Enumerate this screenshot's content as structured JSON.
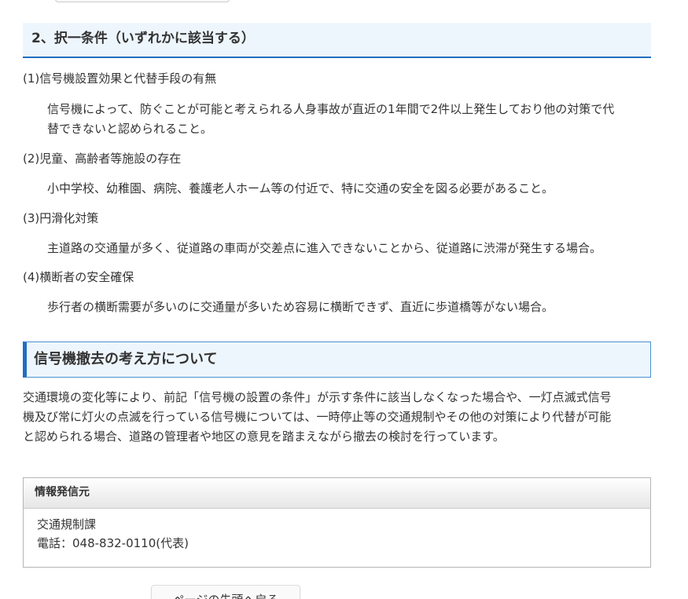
{
  "selection_section": {
    "heading": "2、択一条件（いずれかに該当する）",
    "conditions": [
      {
        "title": "(1)信号機設置効果と代替手段の有無",
        "desc_lines": [
          "信号機によって、防ぐことが可能と考えられる人身事故が直近の1年間で2件以上発生しており他の対策で代",
          "替できないと認められること。"
        ]
      },
      {
        "title": "(2)児童、高齢者等施設の存在",
        "desc_lines": [
          "小中学校、幼稚園、病院、養護老人ホーム等の付近で、特に交通の安全を図る必要があること。"
        ]
      },
      {
        "title": "(3)円滑化対策",
        "desc_lines": [
          "主道路の交通量が多く、従道路の車両が交差点に進入できないことから、従道路に渋滞が発生する場合。"
        ]
      },
      {
        "title": "(4)横断者の安全確保",
        "desc_lines": [
          "歩行者の横断需要が多いのに交通量が多いため容易に横断できず、直近に歩道橋等がない場合。"
        ]
      }
    ]
  },
  "removal_section": {
    "heading": "信号機撤去の考え方について",
    "body_lines": [
      "交通環境の変化等により、前記「信号機の設置の条件」が示す条件に該当しなくなった場合や、一灯点滅式信号",
      "機及び常に灯火の点滅を行っている信号機については、一時停止等の交通規制やその他の対策により代替が可能",
      "と認められる場合、道路の管理者や地区の意見を踏まえながら撤去の検討を行っています。"
    ]
  },
  "info_box": {
    "heading": "情報発信元",
    "department": "交通規制課",
    "phone": "電話：048-832-0110(代表)"
  },
  "back_button": {
    "label": "ページの先頭へ戻る"
  },
  "colors": {
    "accent_blue": "#1f6fbf",
    "heading_bg": "#eef6fd"
  }
}
